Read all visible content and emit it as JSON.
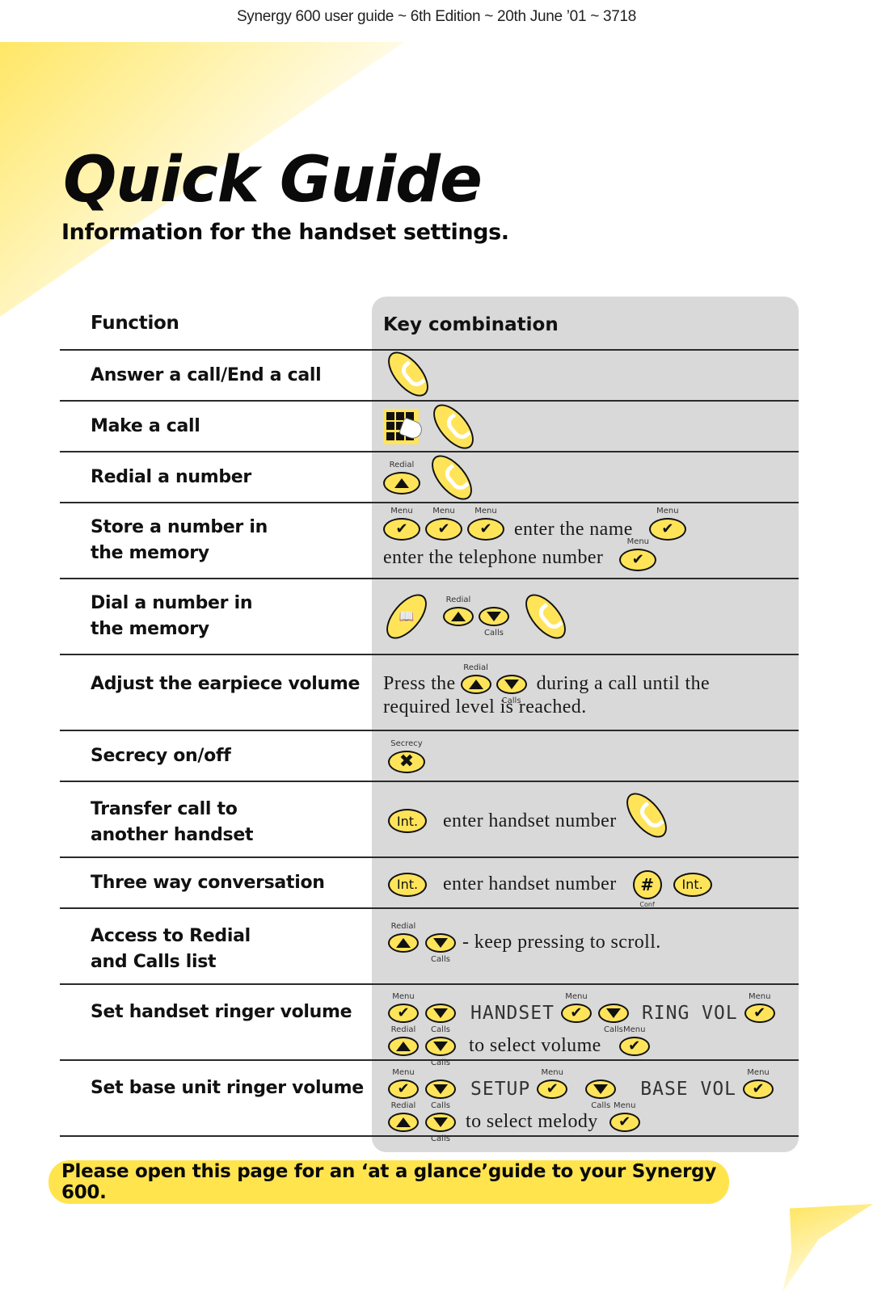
{
  "header": {
    "text": "Synergy 600 user guide ~ 6th Edition ~ 20th June ’01 ~ 3718"
  },
  "title": "Quick Guide",
  "subtitle": "Information for the handset settings.",
  "table": {
    "headers": {
      "function": "Function",
      "keys": "Key combination"
    },
    "key_labels": {
      "menu": "Menu",
      "redial": "Redial",
      "calls": "Calls",
      "secrecy": "Secrecy",
      "conf": "Conf",
      "int": "Int.",
      "hash": "#"
    },
    "icons": {
      "check": "✔",
      "cross": "✖",
      "book": "🕮"
    },
    "rows": [
      {
        "function": "Answer a call/End a call"
      },
      {
        "function": "Make a call"
      },
      {
        "function": "Redial a number"
      },
      {
        "function": "Store a number in the memory",
        "text1": "enter the name",
        "text2": "enter the telephone number"
      },
      {
        "function": "Dial a number in the memory"
      },
      {
        "function": "Adjust the earpiece volume",
        "text1": "Press the",
        "text2": "during a call until the",
        "text3": "required level is reached."
      },
      {
        "function": "Secrecy on/off"
      },
      {
        "function": "Transfer call to another handset",
        "text1": "enter handset number"
      },
      {
        "function": "Three way conversation",
        "text1": "enter handset number"
      },
      {
        "function": "Access to Redial and Calls list",
        "text1": "- keep pressing to scroll."
      },
      {
        "function": "Set handset ringer volume",
        "lcd1": "HANDSET",
        "lcd2": "RING VOL",
        "text1": "to select volume"
      },
      {
        "function": "Set base unit ringer volume",
        "lcd1": "SETUP",
        "lcd2": "BASE VOL",
        "text1": "to select melody"
      }
    ]
  },
  "banner": "Please open this page for an ‘at a glance’guide to your Synergy 600.",
  "colors": {
    "accent_yellow": "#ffe44e",
    "panel_gray": "#d9d9d9"
  }
}
